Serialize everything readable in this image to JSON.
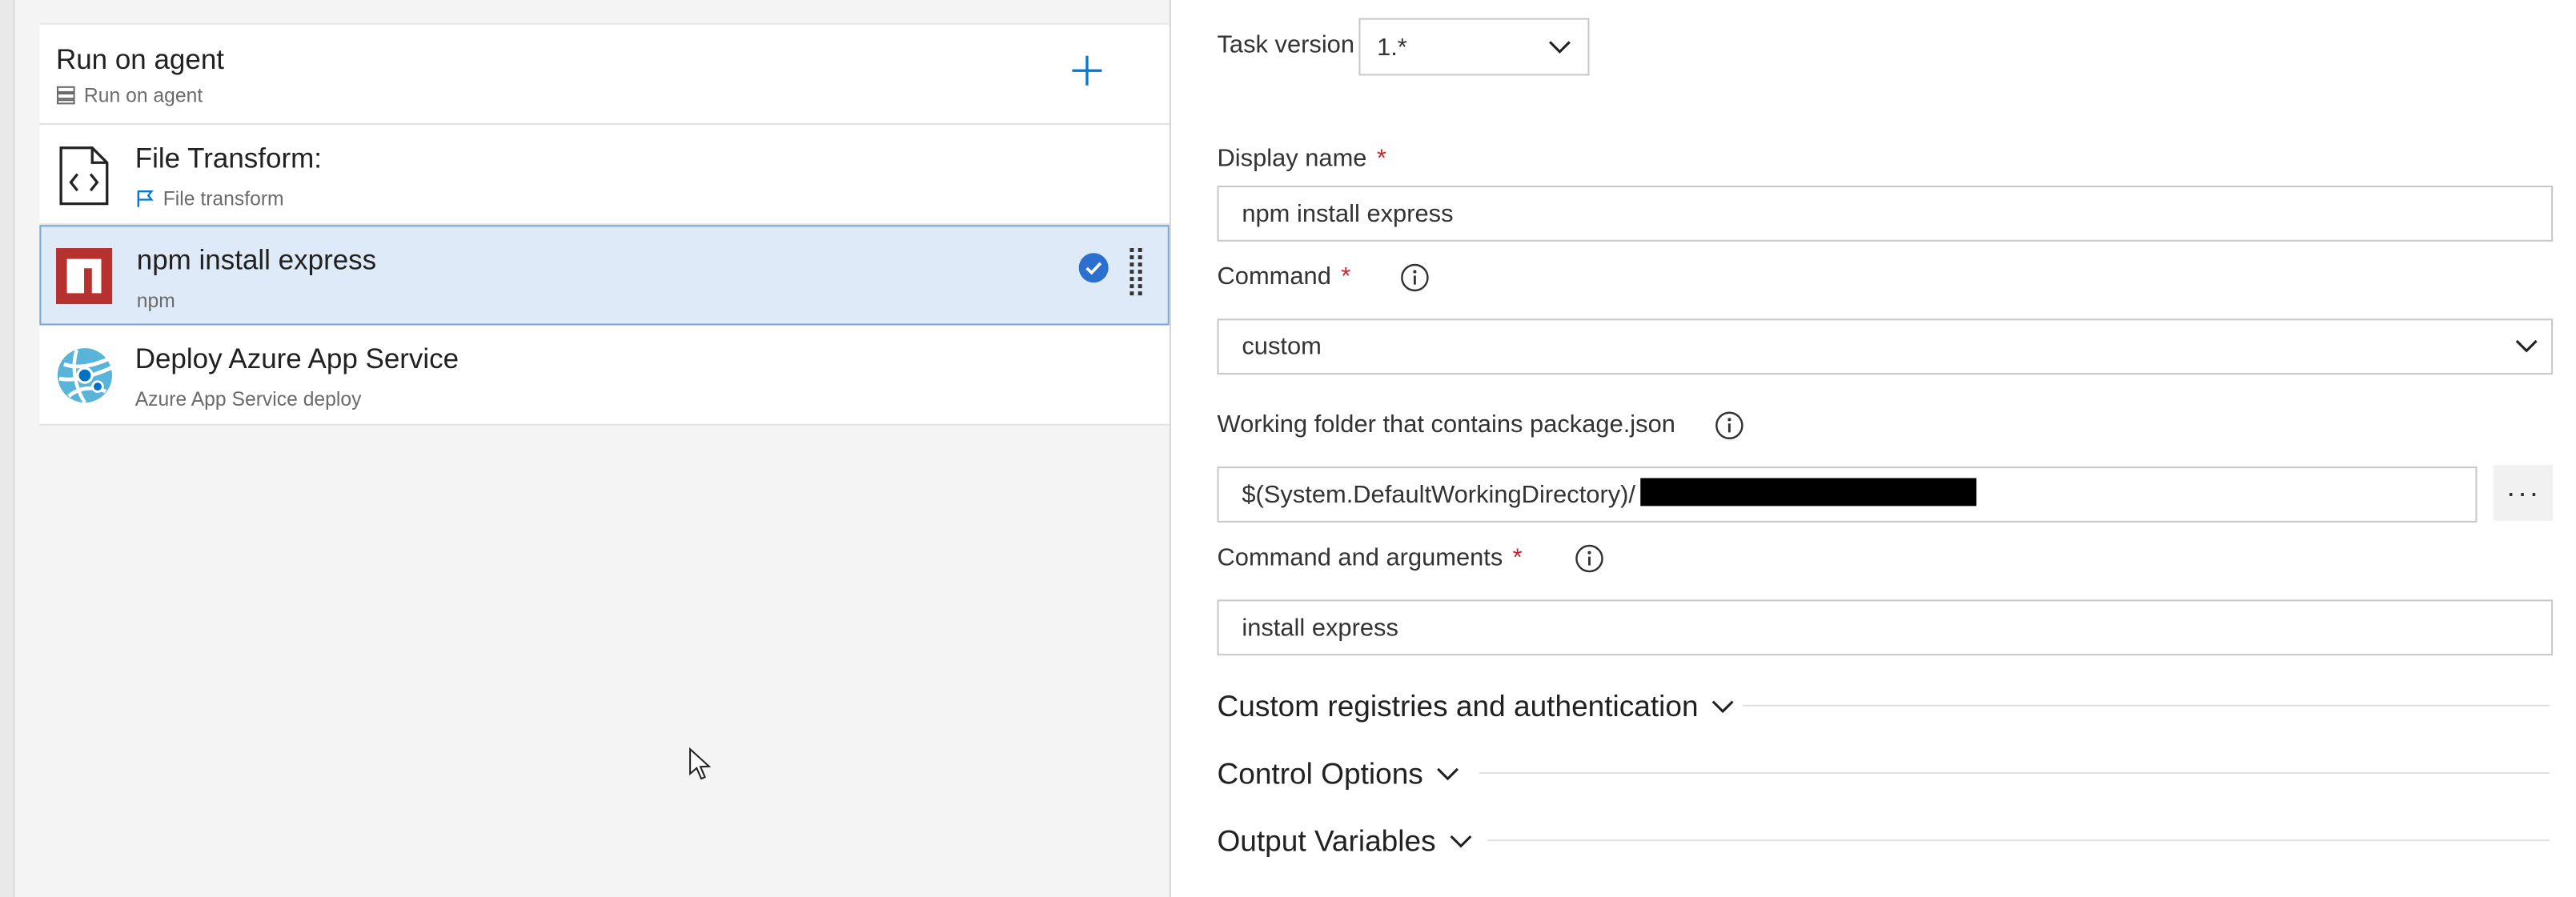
{
  "pipeline": {
    "phase": {
      "title": "Run on agent",
      "subtitle": "Run on agent"
    },
    "tasks": [
      {
        "title": "File Transform:",
        "subtitle": "File transform",
        "icon": "file-code-icon"
      },
      {
        "title": "npm install express",
        "subtitle": "npm",
        "icon": "npm-logo-icon",
        "selected": true
      },
      {
        "title": "Deploy Azure App Service",
        "subtitle": "Azure App Service deploy",
        "icon": "azure-app-service-icon"
      }
    ]
  },
  "form": {
    "task_version": {
      "label": "Task version",
      "value": "1.*"
    },
    "display_name": {
      "label": "Display name",
      "required_mark": "*",
      "value": "npm install express"
    },
    "command": {
      "label": "Command",
      "required_mark": "*",
      "value": "custom"
    },
    "working_folder": {
      "label": "Working folder that contains package.json",
      "value": "$(System.DefaultWorkingDirectory)/",
      "browse_label": "···"
    },
    "command_args": {
      "label": "Command and arguments",
      "required_mark": "*",
      "value": "install express"
    },
    "sections": [
      {
        "label": "Custom registries and authentication"
      },
      {
        "label": "Control Options"
      },
      {
        "label": "Output Variables"
      }
    ]
  },
  "colors": {
    "accent": "#0078d4",
    "selected_bg": "#dfeaf8",
    "npm_red": "#b7322f",
    "azure_blue": "#59b4d9",
    "required": "#c4262e"
  }
}
